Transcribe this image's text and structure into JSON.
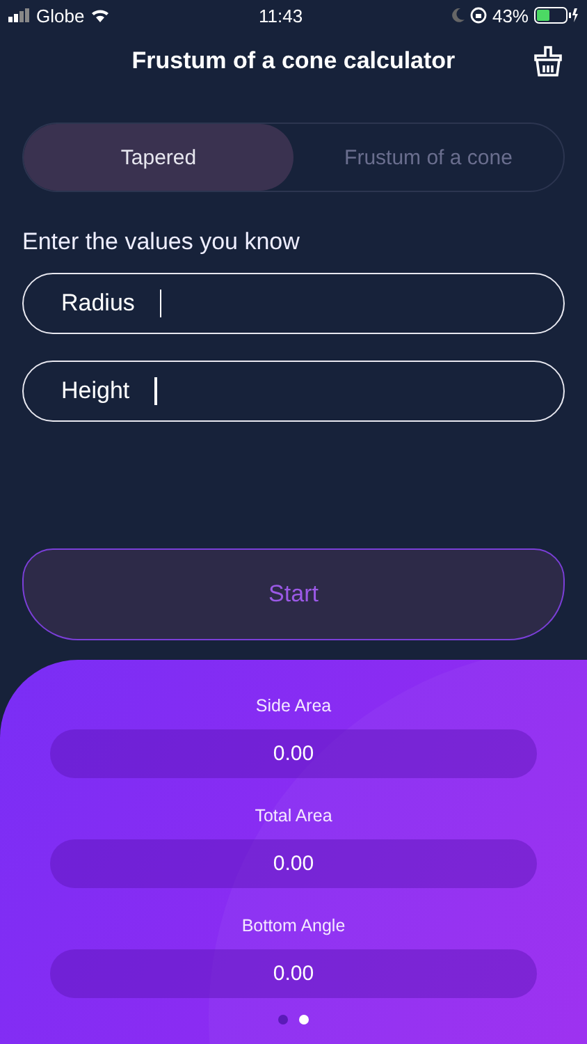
{
  "status_bar": {
    "carrier": "Globe",
    "time": "11:43",
    "battery": "43%"
  },
  "title": "Frustum of a cone calculator",
  "tabs": [
    {
      "label": "Tapered",
      "selected": true
    },
    {
      "label": "Frustum of a cone",
      "selected": false
    }
  ],
  "prompt": "Enter the values you know",
  "fields": [
    {
      "placeholder": "Radius"
    },
    {
      "placeholder": "Height"
    }
  ],
  "start_button": "Start",
  "results": [
    {
      "label": "Side Area",
      "value": "0.00"
    },
    {
      "label": "Total Area",
      "value": "0.00"
    },
    {
      "label": "Bottom Angle",
      "value": "0.00"
    }
  ],
  "pages": [
    {
      "selected": false
    },
    {
      "selected": true
    }
  ]
}
